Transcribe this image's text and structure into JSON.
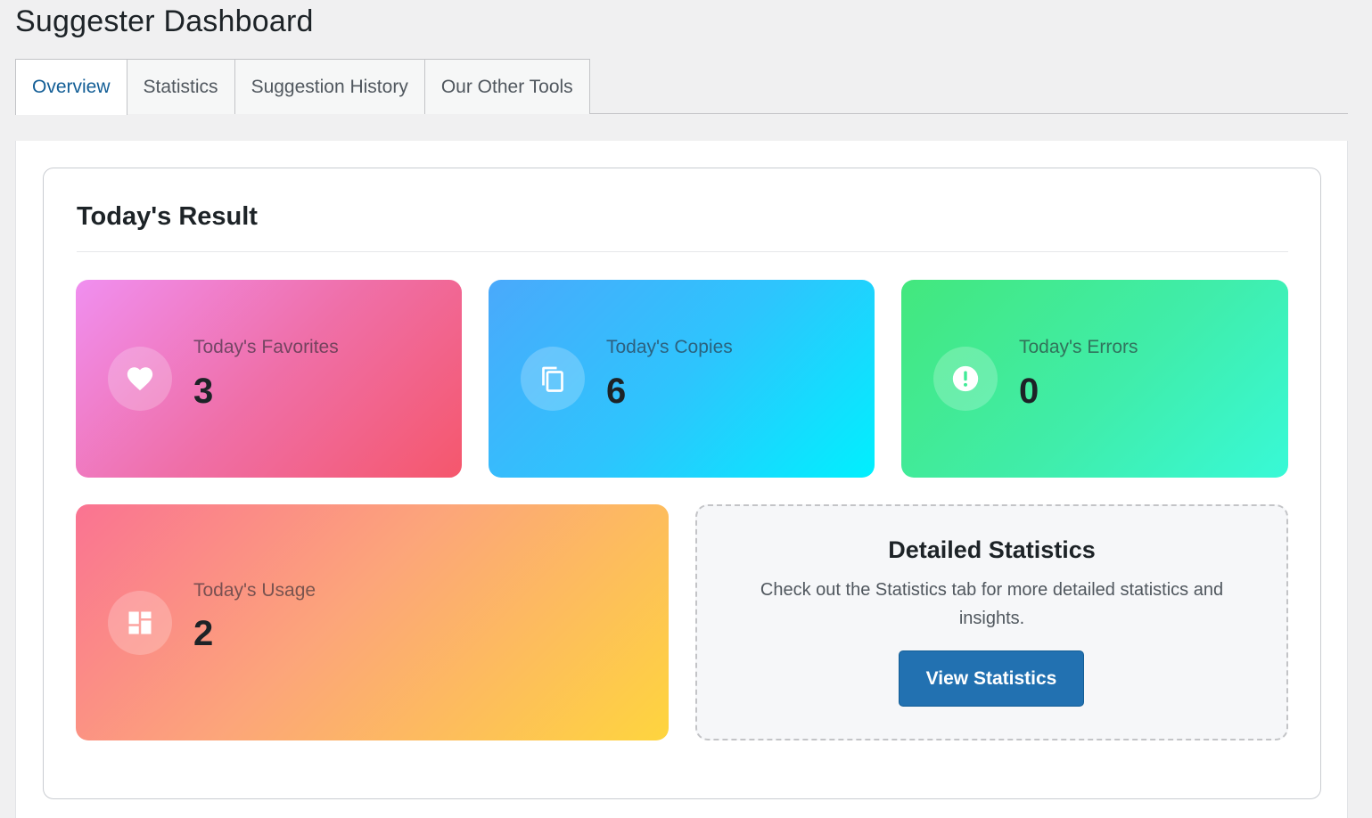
{
  "page": {
    "title": "Suggester Dashboard"
  },
  "tabs": [
    {
      "label": "Overview",
      "active": true
    },
    {
      "label": "Statistics",
      "active": false
    },
    {
      "label": "Suggestion History",
      "active": false
    },
    {
      "label": "Our Other Tools",
      "active": false
    }
  ],
  "results": {
    "title": "Today's Result",
    "stats": [
      {
        "label": "Today's Favorites",
        "value": "3",
        "icon": "heart-icon"
      },
      {
        "label": "Today's Copies",
        "value": "6",
        "icon": "copy-icon"
      },
      {
        "label": "Today's Errors",
        "value": "0",
        "icon": "error-icon"
      },
      {
        "label": "Today's Usage",
        "value": "2",
        "icon": "dashboard-icon"
      }
    ],
    "detail": {
      "title": "Detailed Statistics",
      "text": "Check out the Statistics tab for more detailed statistics and insights.",
      "button_label": "View Statistics"
    }
  },
  "colors": {
    "accent": "#2271b1",
    "active_tab_text": "#135e96",
    "favorites_gradient": [
      "#f093fb",
      "#f5576c"
    ],
    "copies_gradient": [
      "#4facfe",
      "#00f2fe"
    ],
    "errors_gradient": [
      "#43e97b",
      "#38f9d7"
    ],
    "usage_gradient": [
      "#fa709a",
      "#fee140"
    ]
  }
}
